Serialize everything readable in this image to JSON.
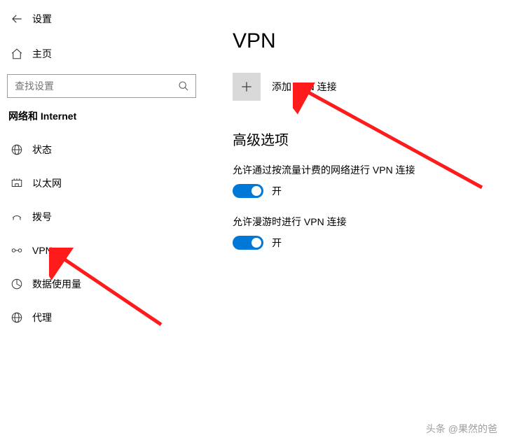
{
  "header": {
    "back_title": "设置"
  },
  "sidebar": {
    "home_label": "主页",
    "search_placeholder": "查找设置",
    "category_label": "网络和 Internet",
    "items": [
      {
        "label": "状态"
      },
      {
        "label": "以太网"
      },
      {
        "label": "拨号"
      },
      {
        "label": "VPN"
      },
      {
        "label": "数据使用量"
      },
      {
        "label": "代理"
      }
    ]
  },
  "content": {
    "title": "VPN",
    "add_label": "添加 VPN 连接",
    "advanced_title": "高级选项",
    "options": [
      {
        "text": "允许通过按流量计费的网络进行 VPN 连接",
        "state": "开"
      },
      {
        "text": "允许漫游时进行 VPN 连接",
        "state": "开"
      }
    ]
  },
  "watermark": "头条 @果然的爸"
}
